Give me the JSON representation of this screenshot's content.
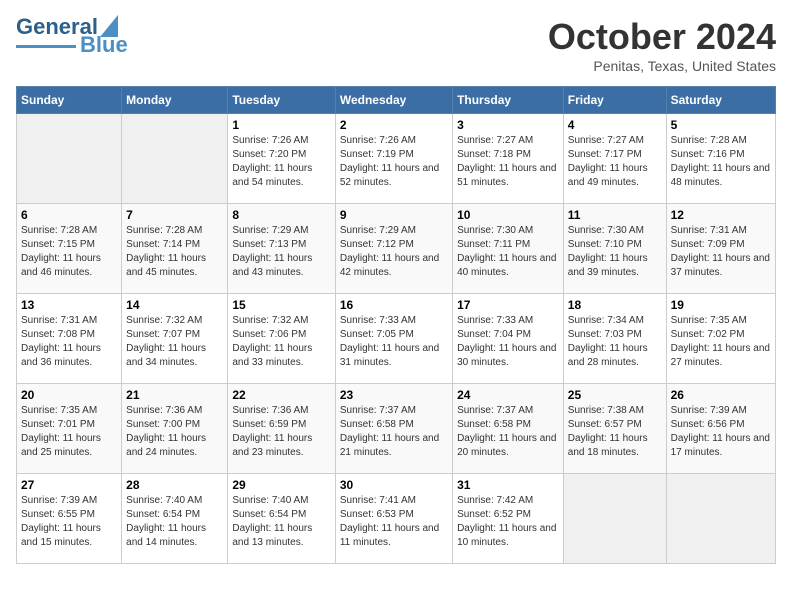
{
  "header": {
    "logo_general": "General",
    "logo_blue": "Blue",
    "title": "October 2024",
    "subtitle": "Penitas, Texas, United States"
  },
  "calendar": {
    "days_of_week": [
      "Sunday",
      "Monday",
      "Tuesday",
      "Wednesday",
      "Thursday",
      "Friday",
      "Saturday"
    ],
    "weeks": [
      [
        {
          "day": "",
          "sunrise": "",
          "sunset": "",
          "daylight": ""
        },
        {
          "day": "",
          "sunrise": "",
          "sunset": "",
          "daylight": ""
        },
        {
          "day": "1",
          "sunrise": "Sunrise: 7:26 AM",
          "sunset": "Sunset: 7:20 PM",
          "daylight": "Daylight: 11 hours and 54 minutes."
        },
        {
          "day": "2",
          "sunrise": "Sunrise: 7:26 AM",
          "sunset": "Sunset: 7:19 PM",
          "daylight": "Daylight: 11 hours and 52 minutes."
        },
        {
          "day": "3",
          "sunrise": "Sunrise: 7:27 AM",
          "sunset": "Sunset: 7:18 PM",
          "daylight": "Daylight: 11 hours and 51 minutes."
        },
        {
          "day": "4",
          "sunrise": "Sunrise: 7:27 AM",
          "sunset": "Sunset: 7:17 PM",
          "daylight": "Daylight: 11 hours and 49 minutes."
        },
        {
          "day": "5",
          "sunrise": "Sunrise: 7:28 AM",
          "sunset": "Sunset: 7:16 PM",
          "daylight": "Daylight: 11 hours and 48 minutes."
        }
      ],
      [
        {
          "day": "6",
          "sunrise": "Sunrise: 7:28 AM",
          "sunset": "Sunset: 7:15 PM",
          "daylight": "Daylight: 11 hours and 46 minutes."
        },
        {
          "day": "7",
          "sunrise": "Sunrise: 7:28 AM",
          "sunset": "Sunset: 7:14 PM",
          "daylight": "Daylight: 11 hours and 45 minutes."
        },
        {
          "day": "8",
          "sunrise": "Sunrise: 7:29 AM",
          "sunset": "Sunset: 7:13 PM",
          "daylight": "Daylight: 11 hours and 43 minutes."
        },
        {
          "day": "9",
          "sunrise": "Sunrise: 7:29 AM",
          "sunset": "Sunset: 7:12 PM",
          "daylight": "Daylight: 11 hours and 42 minutes."
        },
        {
          "day": "10",
          "sunrise": "Sunrise: 7:30 AM",
          "sunset": "Sunset: 7:11 PM",
          "daylight": "Daylight: 11 hours and 40 minutes."
        },
        {
          "day": "11",
          "sunrise": "Sunrise: 7:30 AM",
          "sunset": "Sunset: 7:10 PM",
          "daylight": "Daylight: 11 hours and 39 minutes."
        },
        {
          "day": "12",
          "sunrise": "Sunrise: 7:31 AM",
          "sunset": "Sunset: 7:09 PM",
          "daylight": "Daylight: 11 hours and 37 minutes."
        }
      ],
      [
        {
          "day": "13",
          "sunrise": "Sunrise: 7:31 AM",
          "sunset": "Sunset: 7:08 PM",
          "daylight": "Daylight: 11 hours and 36 minutes."
        },
        {
          "day": "14",
          "sunrise": "Sunrise: 7:32 AM",
          "sunset": "Sunset: 7:07 PM",
          "daylight": "Daylight: 11 hours and 34 minutes."
        },
        {
          "day": "15",
          "sunrise": "Sunrise: 7:32 AM",
          "sunset": "Sunset: 7:06 PM",
          "daylight": "Daylight: 11 hours and 33 minutes."
        },
        {
          "day": "16",
          "sunrise": "Sunrise: 7:33 AM",
          "sunset": "Sunset: 7:05 PM",
          "daylight": "Daylight: 11 hours and 31 minutes."
        },
        {
          "day": "17",
          "sunrise": "Sunrise: 7:33 AM",
          "sunset": "Sunset: 7:04 PM",
          "daylight": "Daylight: 11 hours and 30 minutes."
        },
        {
          "day": "18",
          "sunrise": "Sunrise: 7:34 AM",
          "sunset": "Sunset: 7:03 PM",
          "daylight": "Daylight: 11 hours and 28 minutes."
        },
        {
          "day": "19",
          "sunrise": "Sunrise: 7:35 AM",
          "sunset": "Sunset: 7:02 PM",
          "daylight": "Daylight: 11 hours and 27 minutes."
        }
      ],
      [
        {
          "day": "20",
          "sunrise": "Sunrise: 7:35 AM",
          "sunset": "Sunset: 7:01 PM",
          "daylight": "Daylight: 11 hours and 25 minutes."
        },
        {
          "day": "21",
          "sunrise": "Sunrise: 7:36 AM",
          "sunset": "Sunset: 7:00 PM",
          "daylight": "Daylight: 11 hours and 24 minutes."
        },
        {
          "day": "22",
          "sunrise": "Sunrise: 7:36 AM",
          "sunset": "Sunset: 6:59 PM",
          "daylight": "Daylight: 11 hours and 23 minutes."
        },
        {
          "day": "23",
          "sunrise": "Sunrise: 7:37 AM",
          "sunset": "Sunset: 6:58 PM",
          "daylight": "Daylight: 11 hours and 21 minutes."
        },
        {
          "day": "24",
          "sunrise": "Sunrise: 7:37 AM",
          "sunset": "Sunset: 6:58 PM",
          "daylight": "Daylight: 11 hours and 20 minutes."
        },
        {
          "day": "25",
          "sunrise": "Sunrise: 7:38 AM",
          "sunset": "Sunset: 6:57 PM",
          "daylight": "Daylight: 11 hours and 18 minutes."
        },
        {
          "day": "26",
          "sunrise": "Sunrise: 7:39 AM",
          "sunset": "Sunset: 6:56 PM",
          "daylight": "Daylight: 11 hours and 17 minutes."
        }
      ],
      [
        {
          "day": "27",
          "sunrise": "Sunrise: 7:39 AM",
          "sunset": "Sunset: 6:55 PM",
          "daylight": "Daylight: 11 hours and 15 minutes."
        },
        {
          "day": "28",
          "sunrise": "Sunrise: 7:40 AM",
          "sunset": "Sunset: 6:54 PM",
          "daylight": "Daylight: 11 hours and 14 minutes."
        },
        {
          "day": "29",
          "sunrise": "Sunrise: 7:40 AM",
          "sunset": "Sunset: 6:54 PM",
          "daylight": "Daylight: 11 hours and 13 minutes."
        },
        {
          "day": "30",
          "sunrise": "Sunrise: 7:41 AM",
          "sunset": "Sunset: 6:53 PM",
          "daylight": "Daylight: 11 hours and 11 minutes."
        },
        {
          "day": "31",
          "sunrise": "Sunrise: 7:42 AM",
          "sunset": "Sunset: 6:52 PM",
          "daylight": "Daylight: 11 hours and 10 minutes."
        },
        {
          "day": "",
          "sunrise": "",
          "sunset": "",
          "daylight": ""
        },
        {
          "day": "",
          "sunrise": "",
          "sunset": "",
          "daylight": ""
        }
      ]
    ]
  }
}
